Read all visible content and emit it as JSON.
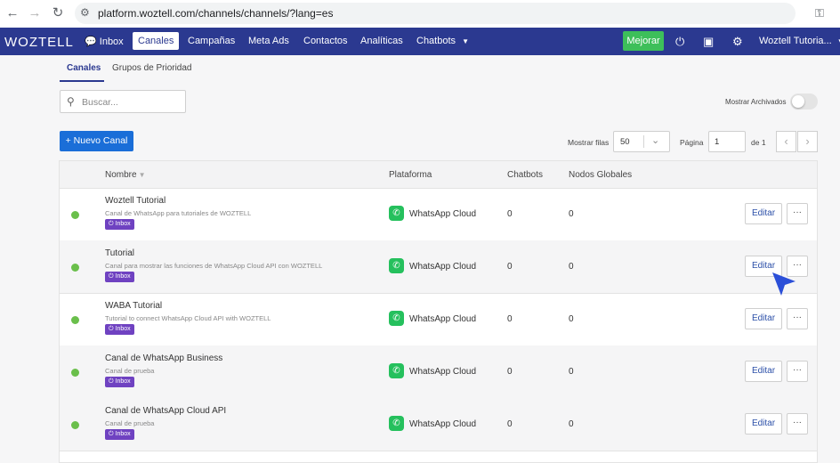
{
  "browser": {
    "url": "platform.woztell.com/channels/channels/?lang=es",
    "back_icon": "arrow-left-icon",
    "forward_icon": "arrow-right-icon",
    "reload_icon": "reload-icon"
  },
  "nav": {
    "logo": "WOZTELL",
    "items": [
      {
        "label": "Inbox",
        "icon": "chat-bubble-icon"
      },
      {
        "label": "Canales",
        "active": true
      },
      {
        "label": "Campañas"
      },
      {
        "label": "Meta Ads"
      },
      {
        "label": "Contactos"
      },
      {
        "label": "Analíticas"
      },
      {
        "label": "Chatbots",
        "dropdown": true
      }
    ],
    "upgrade_label": "Mejorar",
    "user_label": "Woztell Tutoria...",
    "icons": [
      "plug-icon",
      "store-icon",
      "gear-icon"
    ]
  },
  "subtabs": [
    "Canales",
    "Grupos de Prioridad"
  ],
  "search": {
    "placeholder": "Buscar..."
  },
  "archived_label": "Mostrar Archivados",
  "archived_on": false,
  "new_channel_label": "+ Nuevo Canal",
  "pagination": {
    "rows_label": "Mostrar filas",
    "rows_value": "50",
    "page_label": "Página",
    "page_value": "1",
    "of_label": "de 1"
  },
  "table": {
    "headers": [
      "Nombre",
      "Plataforma",
      "Chatbots",
      "Nodos Globales"
    ],
    "rows": [
      {
        "name": "Woztell Tutorial",
        "desc": "Canal de WhatsApp para tutoriales de WOZTELL",
        "badge": "Inbox",
        "platform": "WhatsApp Cloud",
        "chatbots": "0",
        "nodos": "0",
        "edit": "Editar",
        "more": "···"
      },
      {
        "name": "Tutorial",
        "desc": "Canal para mostrar las funciones de WhatsApp Cloud API con WOZTELL",
        "badge": "Inbox",
        "platform": "WhatsApp Cloud",
        "chatbots": "0",
        "nodos": "0",
        "edit": "Editar",
        "more": "···"
      },
      {
        "name": "WABA Tutorial",
        "desc": "Tutorial to connect WhatsApp Cloud API with WOZTELL",
        "badge": "Inbox",
        "platform": "WhatsApp Cloud",
        "chatbots": "0",
        "nodos": "0",
        "edit": "Editar",
        "more": "···"
      },
      {
        "name": "Canal de WhatsApp Business",
        "desc": "Canal de prueba",
        "badge": "Inbox",
        "platform": "WhatsApp Cloud",
        "chatbots": "0",
        "nodos": "0",
        "edit": "Editar",
        "more": "···"
      },
      {
        "name": "Canal de WhatsApp Cloud API",
        "desc": "Canal de prueba",
        "badge": "Inbox",
        "platform": "WhatsApp Cloud",
        "chatbots": "0",
        "nodos": "0",
        "edit": "Editar",
        "more": "···"
      }
    ]
  },
  "colors": {
    "nav_bg": "#2b3990",
    "upgrade_bg": "#3dbf5a",
    "primary_button": "#1a6ed8",
    "status_active": "#6abf4b",
    "badge_bg": "#6f42c1",
    "whatsapp": "#25c05d"
  }
}
